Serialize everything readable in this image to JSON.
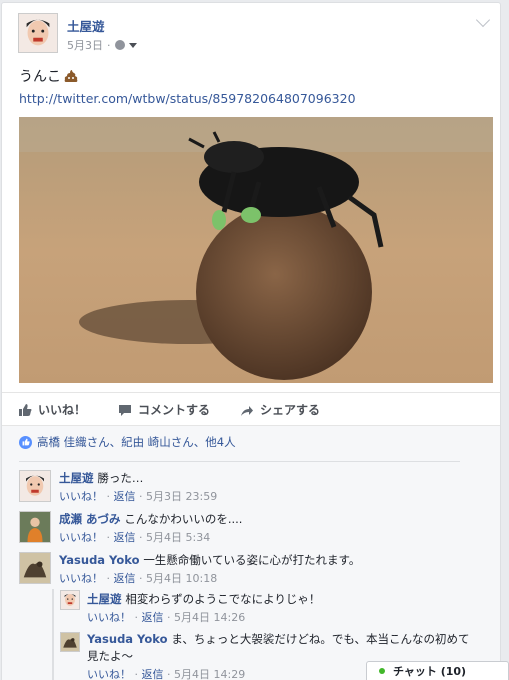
{
  "post": {
    "author": "土屋遊",
    "date": "5月3日",
    "text": "うんこ",
    "link": "http://twitter.com/wtbw/status/859782064807096320"
  },
  "actions": {
    "like": "いいね！",
    "comment": "コメントする",
    "share": "シェアする"
  },
  "likes_summary": "高橋 佳織さん、紀由 崎山さん、他4人",
  "comments": [
    {
      "author": "土屋遊",
      "text": "勝った…",
      "like": "いいね！",
      "reply": "返信",
      "time": "5月3日 23:59"
    },
    {
      "author": "成瀬 あづみ",
      "text": "こんなかわいいのを....",
      "like": "いいね！",
      "reply": "返信",
      "time": "5月4日 5:34"
    },
    {
      "author": "Yasuda Yoko",
      "text": "一生懸命働いている姿に心が打たれます。",
      "like": "いいね！",
      "reply": "返信",
      "time": "5月4日 10:18"
    }
  ],
  "replies": [
    {
      "author": "土屋遊",
      "text": "相変わらずのようこでなによりじゃ！",
      "like": "いいね！",
      "reply": "返信",
      "time": "5月4日 14:26"
    },
    {
      "author": "Yasuda Yoko",
      "text": "ま、ちょっと大袈裟だけどね。でも、本当こんなの初めて",
      "text2": "見たよ〜",
      "like": "いいね！",
      "reply": "返信",
      "time": "5月4日 14:29"
    }
  ],
  "chat": {
    "label": "チャット (10)"
  },
  "icons": [
    "chevron-down-icon",
    "globe-icon",
    "poop-emoji-icon",
    "thumb-up-icon",
    "comment-icon",
    "share-icon",
    "online-dot-icon"
  ],
  "colors": {
    "link": "#365899",
    "like_badge": "#5890ff",
    "online": "#42b72a"
  }
}
